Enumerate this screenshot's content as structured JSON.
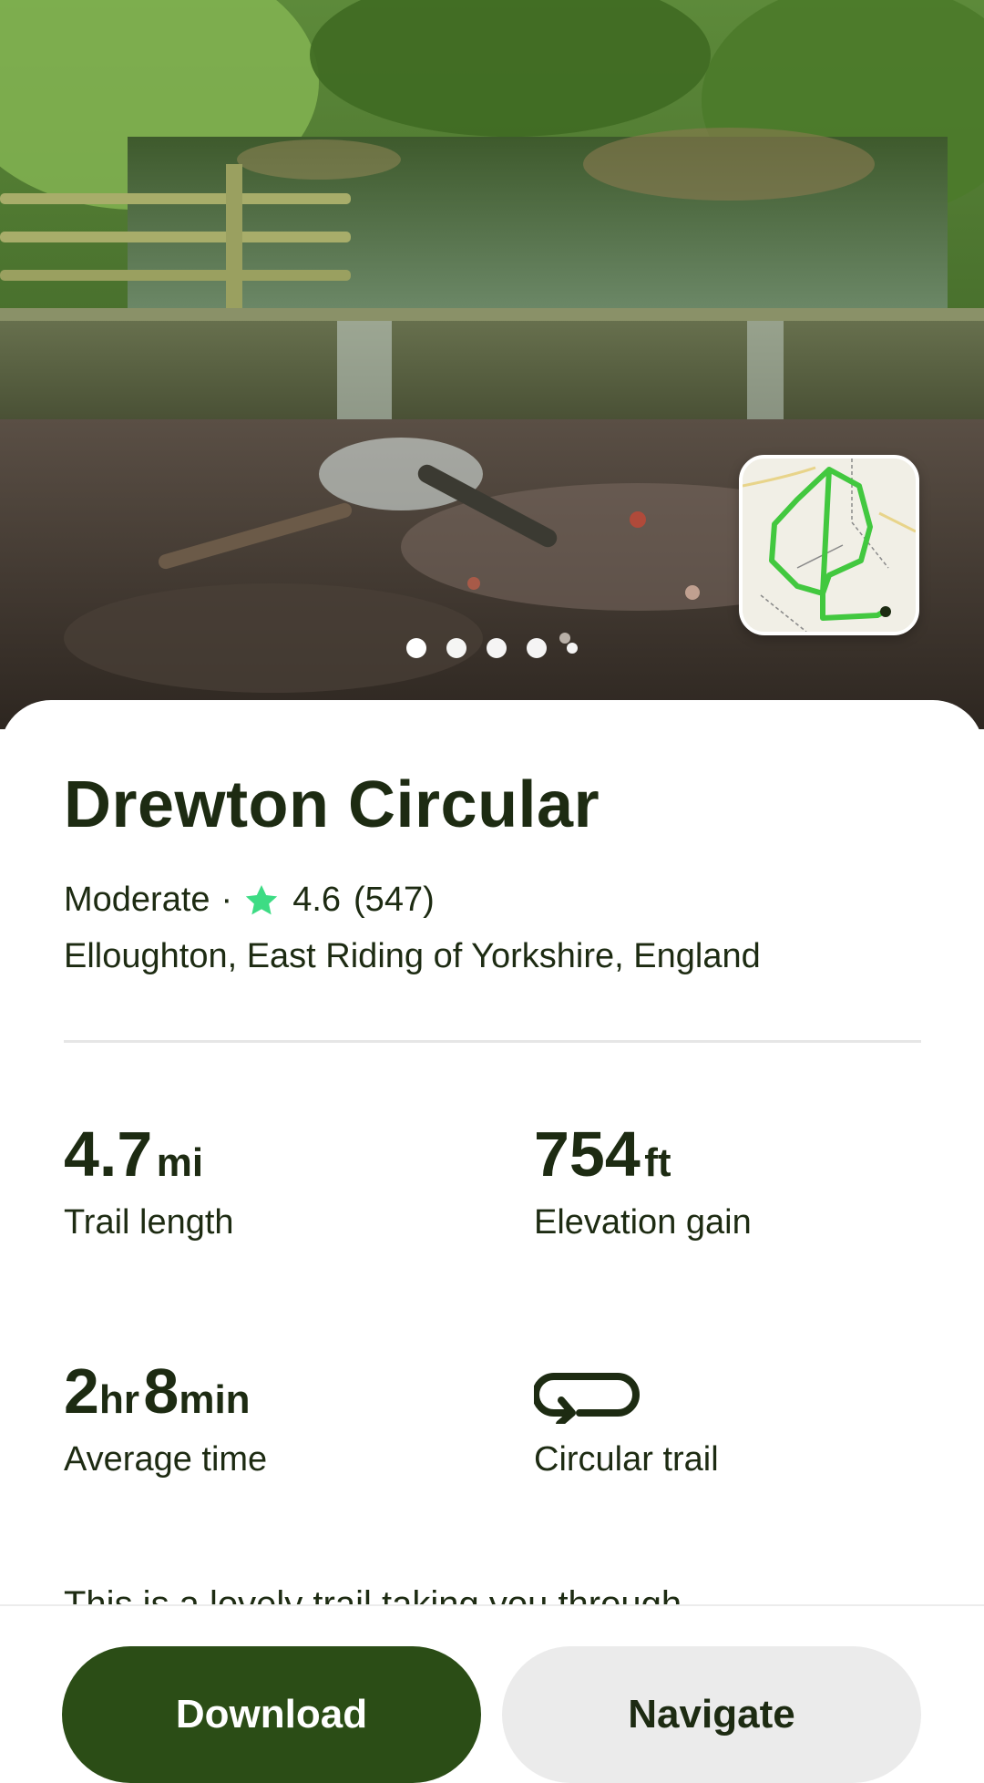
{
  "hero": {
    "carousel_dots": 5,
    "active_index": 0
  },
  "trail": {
    "name": "Drewton Circular",
    "difficulty": "Moderate",
    "separator": "·",
    "rating": "4.6",
    "review_count": "(547)",
    "location": "Elloughton, East Riding of Yorkshire, England"
  },
  "stats": {
    "length": {
      "value": "4.7",
      "unit": "mi",
      "label": "Trail length"
    },
    "elevation": {
      "value": "754",
      "unit": "ft",
      "label": "Elevation gain"
    },
    "time": {
      "hours": "2",
      "hours_unit": "hr",
      "minutes": "8",
      "minutes_unit": "min",
      "label": "Average time"
    },
    "route_type": {
      "icon": "loop-icon",
      "label": "Circular trail"
    }
  },
  "description_preview": "This is a lovely trail taking you through",
  "actions": {
    "download_label": "Download",
    "navigate_label": "Navigate"
  },
  "colors": {
    "brand_dark_green": "#2b4d16",
    "star_green": "#3ddc84",
    "route_green": "#42c83f",
    "text": "#1d2b12"
  }
}
